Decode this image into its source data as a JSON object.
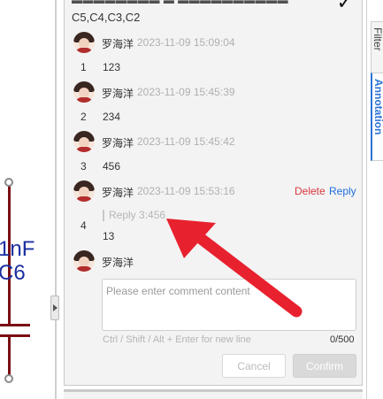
{
  "schematic": {
    "cap_value": "1nF",
    "cap_designator": "C6"
  },
  "panel": {
    "partial_title": "Comments",
    "designators": "C5,C4,C3,C2"
  },
  "comments": [
    {
      "index": "1",
      "author": "罗海洋",
      "time": "2023-11-09 15:09:04",
      "text": "123"
    },
    {
      "index": "2",
      "author": "罗海洋",
      "time": "2023-11-09 15:45:39",
      "text": "234"
    },
    {
      "index": "3",
      "author": "罗海洋",
      "time": "2023-11-09 15:45:42",
      "text": "456"
    },
    {
      "index": "4",
      "author": "罗海洋",
      "time": "2023-11-09 15:53:16",
      "reply_quote": "Reply 3:456",
      "text": "13",
      "delete_label": "Delete",
      "reply_label": "Reply"
    }
  ],
  "composer": {
    "author": "罗海洋",
    "placeholder": "Please enter comment content",
    "value": "",
    "hint": "Ctrl / Shift / Alt + Enter for new line",
    "counter": "0/500",
    "cancel_label": "Cancel",
    "confirm_label": "Confirm"
  },
  "side_tabs": {
    "filter": "Filter",
    "annotation": "Annotation"
  },
  "colors": {
    "accent": "#2b73d6",
    "delete": "#d9363e",
    "arrow": "#e8212e",
    "wire": "#7a0f14",
    "designator": "#1a2fa0"
  }
}
